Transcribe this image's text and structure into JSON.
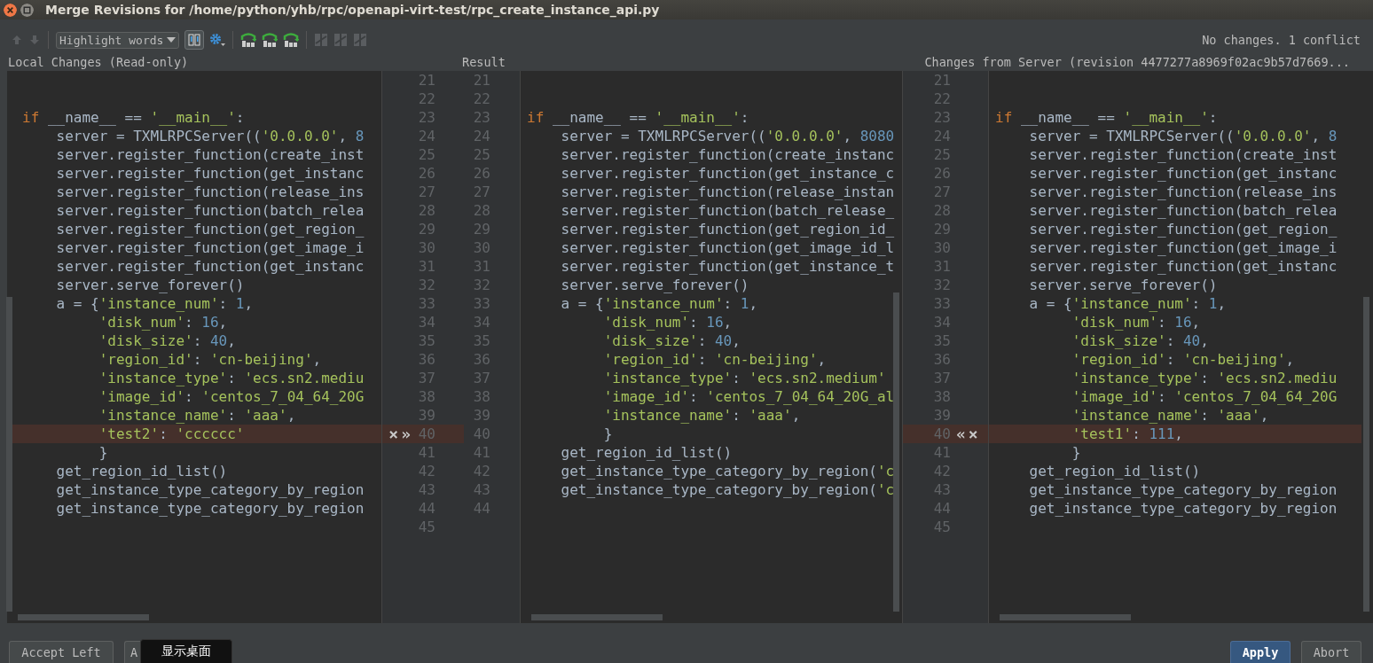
{
  "window": {
    "title": "Merge Revisions for /home/python/yhb/rpc/openapi-virt-test/rpc_create_instance_api.py"
  },
  "toolbar": [
    {
      "kind": "up",
      "disabled": true
    },
    {
      "kind": "down",
      "disabled": true
    },
    {
      "kind": "dropdown",
      "value": "Highlight words"
    },
    {
      "kind": "toggle",
      "selected": true
    },
    {
      "kind": "gear"
    },
    {
      "kind": "apply",
      "disabled": false
    },
    {
      "kind": "apply",
      "disabled": false
    },
    {
      "kind": "apply",
      "disabled": false
    },
    {
      "kind": "resolve",
      "disabled": true
    },
    {
      "kind": "resolve",
      "disabled": true
    },
    {
      "kind": "resolve",
      "disabled": true
    }
  ],
  "status": "No changes. 1 conflict",
  "headers": {
    "left": "Local Changes (Read-only)",
    "result": "Result",
    "right": "Changes from Server (revision 4477277a8969f02ac9b57d7669..."
  },
  "left_pane": {
    "lines": [
      {
        "number": "21",
        "conflict": false
      },
      {
        "number": "22",
        "conflict": false
      },
      {
        "number": "23",
        "conflict": false,
        "tokens": [
          {
            "kind": "keyword",
            "text": "if"
          },
          {
            "kind": "plain",
            "text": " __name__ == "
          },
          {
            "kind": "string",
            "text": "'__main__'"
          },
          {
            "kind": "plain",
            "text": ":"
          }
        ]
      },
      {
        "number": "24",
        "conflict": false,
        "tokens": [
          {
            "kind": "plain",
            "text": "    server = TXMLRPCServer(("
          },
          {
            "kind": "string",
            "text": "'0.0.0.0'"
          },
          {
            "kind": "plain",
            "text": ", "
          },
          {
            "kind": "number",
            "text": "8"
          }
        ]
      },
      {
        "number": "25",
        "conflict": false,
        "tokens": [
          {
            "kind": "plain",
            "text": "    server.register_function(create_inst"
          }
        ]
      },
      {
        "number": "26",
        "conflict": false,
        "tokens": [
          {
            "kind": "plain",
            "text": "    server.register_function(get_instanc"
          }
        ]
      },
      {
        "number": "27",
        "conflict": false,
        "tokens": [
          {
            "kind": "plain",
            "text": "    server.register_function(release_ins"
          }
        ]
      },
      {
        "number": "28",
        "conflict": false,
        "tokens": [
          {
            "kind": "plain",
            "text": "    server.register_function(batch_relea"
          }
        ]
      },
      {
        "number": "29",
        "conflict": false,
        "tokens": [
          {
            "kind": "plain",
            "text": "    server.register_function(get_region_"
          }
        ]
      },
      {
        "number": "30",
        "conflict": false,
        "tokens": [
          {
            "kind": "plain",
            "text": "    server.register_function(get_image_i"
          }
        ]
      },
      {
        "number": "31",
        "conflict": false,
        "tokens": [
          {
            "kind": "plain",
            "text": "    server.register_function(get_instanc"
          }
        ]
      },
      {
        "number": "32",
        "conflict": false,
        "tokens": [
          {
            "kind": "plain",
            "text": "    server.serve_forever()"
          }
        ]
      },
      {
        "number": "33",
        "conflict": false,
        "tokens": [
          {
            "kind": "plain",
            "text": "    a = {"
          },
          {
            "kind": "string",
            "text": "'instance_num'"
          },
          {
            "kind": "plain",
            "text": ": "
          },
          {
            "kind": "number",
            "text": "1"
          },
          {
            "kind": "plain",
            "text": ","
          }
        ]
      },
      {
        "number": "34",
        "conflict": false,
        "tokens": [
          {
            "kind": "string",
            "text": "         'disk_num'"
          },
          {
            "kind": "plain",
            "text": ": "
          },
          {
            "kind": "number",
            "text": "16"
          },
          {
            "kind": "plain",
            "text": ","
          }
        ]
      },
      {
        "number": "35",
        "conflict": false,
        "tokens": [
          {
            "kind": "string",
            "text": "         'disk_size'"
          },
          {
            "kind": "plain",
            "text": ": "
          },
          {
            "kind": "number",
            "text": "40"
          },
          {
            "kind": "plain",
            "text": ","
          }
        ]
      },
      {
        "number": "36",
        "conflict": false,
        "tokens": [
          {
            "kind": "string",
            "text": "         'region_id'"
          },
          {
            "kind": "plain",
            "text": ": "
          },
          {
            "kind": "string",
            "text": "'cn-beijing'"
          },
          {
            "kind": "plain",
            "text": ","
          }
        ]
      },
      {
        "number": "37",
        "conflict": false,
        "tokens": [
          {
            "kind": "string",
            "text": "         'instance_type'"
          },
          {
            "kind": "plain",
            "text": ": "
          },
          {
            "kind": "string",
            "text": "'ecs.sn2.mediu"
          }
        ]
      },
      {
        "number": "38",
        "conflict": false,
        "tokens": [
          {
            "kind": "string",
            "text": "         'image_id'"
          },
          {
            "kind": "plain",
            "text": ": "
          },
          {
            "kind": "string",
            "text": "'centos_7_04_64_20G"
          }
        ]
      },
      {
        "number": "39",
        "conflict": false,
        "tokens": [
          {
            "kind": "string",
            "text": "         'instance_name'"
          },
          {
            "kind": "plain",
            "text": ": "
          },
          {
            "kind": "string",
            "text": "'aaa'"
          },
          {
            "kind": "plain",
            "text": ","
          }
        ]
      },
      {
        "number": "40",
        "conflict": true,
        "markers": [
          "×",
          "»"
        ],
        "tokens": [
          {
            "kind": "string",
            "text": "         'test2'"
          },
          {
            "kind": "plain",
            "text": ": "
          },
          {
            "kind": "string",
            "text": "'cccccc'"
          }
        ]
      },
      {
        "number": "41",
        "conflict": false,
        "tokens": [
          {
            "kind": "plain",
            "text": "         }"
          }
        ]
      },
      {
        "number": "42",
        "conflict": false,
        "tokens": [
          {
            "kind": "plain",
            "text": "    get_region_id_list()"
          }
        ]
      },
      {
        "number": "43",
        "conflict": false,
        "tokens": [
          {
            "kind": "plain",
            "text": "    get_instance_type_category_by_region"
          }
        ]
      },
      {
        "number": "44",
        "conflict": false,
        "tokens": [
          {
            "kind": "plain",
            "text": "    get_instance_type_category_by_region"
          }
        ]
      },
      {
        "number": "45",
        "conflict": false
      }
    ]
  },
  "result_pane": {
    "lines": [
      {
        "number": "21"
      },
      {
        "number": "22"
      },
      {
        "number": "23",
        "tokens": [
          {
            "kind": "keyword",
            "text": "if"
          },
          {
            "kind": "plain",
            "text": " __name__ == "
          },
          {
            "kind": "string",
            "text": "'__main__'"
          },
          {
            "kind": "plain",
            "text": ":"
          }
        ]
      },
      {
        "number": "24",
        "tokens": [
          {
            "kind": "plain",
            "text": "    server = TXMLRPCServer(("
          },
          {
            "kind": "string",
            "text": "'0.0.0.0'"
          },
          {
            "kind": "plain",
            "text": ", "
          },
          {
            "kind": "number",
            "text": "8080"
          }
        ]
      },
      {
        "number": "25",
        "tokens": [
          {
            "kind": "plain",
            "text": "    server.register_function(create_instanc"
          }
        ]
      },
      {
        "number": "26",
        "tokens": [
          {
            "kind": "plain",
            "text": "    server.register_function(get_instance_c"
          }
        ]
      },
      {
        "number": "27",
        "tokens": [
          {
            "kind": "plain",
            "text": "    server.register_function(release_instan"
          }
        ]
      },
      {
        "number": "28",
        "tokens": [
          {
            "kind": "plain",
            "text": "    server.register_function(batch_release_"
          }
        ]
      },
      {
        "number": "29",
        "tokens": [
          {
            "kind": "plain",
            "text": "    server.register_function(get_region_id_"
          }
        ]
      },
      {
        "number": "30",
        "tokens": [
          {
            "kind": "plain",
            "text": "    server.register_function(get_image_id_l"
          }
        ]
      },
      {
        "number": "31",
        "tokens": [
          {
            "kind": "plain",
            "text": "    server.register_function(get_instance_t"
          }
        ]
      },
      {
        "number": "32",
        "tokens": [
          {
            "kind": "plain",
            "text": "    server.serve_forever()"
          }
        ]
      },
      {
        "number": "33",
        "tokens": [
          {
            "kind": "plain",
            "text": "    a = {"
          },
          {
            "kind": "string",
            "text": "'instance_num'"
          },
          {
            "kind": "plain",
            "text": ": "
          },
          {
            "kind": "number",
            "text": "1"
          },
          {
            "kind": "plain",
            "text": ","
          }
        ]
      },
      {
        "number": "34",
        "tokens": [
          {
            "kind": "string",
            "text": "         'disk_num'"
          },
          {
            "kind": "plain",
            "text": ": "
          },
          {
            "kind": "number",
            "text": "16"
          },
          {
            "kind": "plain",
            "text": ","
          }
        ]
      },
      {
        "number": "35",
        "tokens": [
          {
            "kind": "string",
            "text": "         'disk_size'"
          },
          {
            "kind": "plain",
            "text": ": "
          },
          {
            "kind": "number",
            "text": "40"
          },
          {
            "kind": "plain",
            "text": ","
          }
        ]
      },
      {
        "number": "36",
        "tokens": [
          {
            "kind": "string",
            "text": "         'region_id'"
          },
          {
            "kind": "plain",
            "text": ": "
          },
          {
            "kind": "string",
            "text": "'cn-beijing'"
          },
          {
            "kind": "plain",
            "text": ","
          }
        ]
      },
      {
        "number": "37",
        "tokens": [
          {
            "kind": "string",
            "text": "         'instance_type'"
          },
          {
            "kind": "plain",
            "text": ": "
          },
          {
            "kind": "string",
            "text": "'ecs.sn2.medium'"
          }
        ]
      },
      {
        "number": "38",
        "tokens": [
          {
            "kind": "string",
            "text": "         'image_id'"
          },
          {
            "kind": "plain",
            "text": ": "
          },
          {
            "kind": "string",
            "text": "'centos_7_04_64_20G_al"
          }
        ]
      },
      {
        "number": "39",
        "tokens": [
          {
            "kind": "string",
            "text": "         'instance_name'"
          },
          {
            "kind": "plain",
            "text": ": "
          },
          {
            "kind": "string",
            "text": "'aaa'"
          },
          {
            "kind": "plain",
            "text": ","
          }
        ]
      },
      {
        "number": "40",
        "tokens": [
          {
            "kind": "plain",
            "text": "         }"
          }
        ]
      },
      {
        "number": "41",
        "tokens": [
          {
            "kind": "plain",
            "text": "    get_region_id_list()"
          }
        ]
      },
      {
        "number": "42",
        "tokens": [
          {
            "kind": "plain",
            "text": "    get_instance_type_category_by_region("
          },
          {
            "kind": "string",
            "text": "'c"
          }
        ]
      },
      {
        "number": "43",
        "tokens": [
          {
            "kind": "plain",
            "text": "    get_instance_type_category_by_region("
          },
          {
            "kind": "string",
            "text": "'c"
          }
        ]
      },
      {
        "number": "44"
      }
    ]
  },
  "right_pane": {
    "lines": [
      {
        "number": "21",
        "conflict": false
      },
      {
        "number": "22",
        "conflict": false
      },
      {
        "number": "23",
        "conflict": false,
        "tokens": [
          {
            "kind": "keyword",
            "text": "if"
          },
          {
            "kind": "plain",
            "text": " __name__ == "
          },
          {
            "kind": "string",
            "text": "'__main__'"
          },
          {
            "kind": "plain",
            "text": ":"
          }
        ]
      },
      {
        "number": "24",
        "conflict": false,
        "tokens": [
          {
            "kind": "plain",
            "text": "    server = TXMLRPCServer(("
          },
          {
            "kind": "string",
            "text": "'0.0.0.0'"
          },
          {
            "kind": "plain",
            "text": ", "
          },
          {
            "kind": "number",
            "text": "8"
          }
        ]
      },
      {
        "number": "25",
        "conflict": false,
        "tokens": [
          {
            "kind": "plain",
            "text": "    server.register_function(create_inst"
          }
        ]
      },
      {
        "number": "26",
        "conflict": false,
        "tokens": [
          {
            "kind": "plain",
            "text": "    server.register_function(get_instanc"
          }
        ]
      },
      {
        "number": "27",
        "conflict": false,
        "tokens": [
          {
            "kind": "plain",
            "text": "    server.register_function(release_ins"
          }
        ]
      },
      {
        "number": "28",
        "conflict": false,
        "tokens": [
          {
            "kind": "plain",
            "text": "    server.register_function(batch_relea"
          }
        ]
      },
      {
        "number": "29",
        "conflict": false,
        "tokens": [
          {
            "kind": "plain",
            "text": "    server.register_function(get_region_"
          }
        ]
      },
      {
        "number": "30",
        "conflict": false,
        "tokens": [
          {
            "kind": "plain",
            "text": "    server.register_function(get_image_i"
          }
        ]
      },
      {
        "number": "31",
        "conflict": false,
        "tokens": [
          {
            "kind": "plain",
            "text": "    server.register_function(get_instanc"
          }
        ]
      },
      {
        "number": "32",
        "conflict": false,
        "tokens": [
          {
            "kind": "plain",
            "text": "    server.serve_forever()"
          }
        ]
      },
      {
        "number": "33",
        "conflict": false,
        "tokens": [
          {
            "kind": "plain",
            "text": "    a = {"
          },
          {
            "kind": "string",
            "text": "'instance_num'"
          },
          {
            "kind": "plain",
            "text": ": "
          },
          {
            "kind": "number",
            "text": "1"
          },
          {
            "kind": "plain",
            "text": ","
          }
        ]
      },
      {
        "number": "34",
        "conflict": false,
        "tokens": [
          {
            "kind": "string",
            "text": "         'disk_num'"
          },
          {
            "kind": "plain",
            "text": ": "
          },
          {
            "kind": "number",
            "text": "16"
          },
          {
            "kind": "plain",
            "text": ","
          }
        ]
      },
      {
        "number": "35",
        "conflict": false,
        "tokens": [
          {
            "kind": "string",
            "text": "         'disk_size'"
          },
          {
            "kind": "plain",
            "text": ": "
          },
          {
            "kind": "number",
            "text": "40"
          },
          {
            "kind": "plain",
            "text": ","
          }
        ]
      },
      {
        "number": "36",
        "conflict": false,
        "tokens": [
          {
            "kind": "string",
            "text": "         'region_id'"
          },
          {
            "kind": "plain",
            "text": ": "
          },
          {
            "kind": "string",
            "text": "'cn-beijing'"
          },
          {
            "kind": "plain",
            "text": ","
          }
        ]
      },
      {
        "number": "37",
        "conflict": false,
        "tokens": [
          {
            "kind": "string",
            "text": "         'instance_type'"
          },
          {
            "kind": "plain",
            "text": ": "
          },
          {
            "kind": "string",
            "text": "'ecs.sn2.mediu"
          }
        ]
      },
      {
        "number": "38",
        "conflict": false,
        "tokens": [
          {
            "kind": "string",
            "text": "         'image_id'"
          },
          {
            "kind": "plain",
            "text": ": "
          },
          {
            "kind": "string",
            "text": "'centos_7_04_64_20G"
          }
        ]
      },
      {
        "number": "39",
        "conflict": false,
        "tokens": [
          {
            "kind": "string",
            "text": "         'instance_name'"
          },
          {
            "kind": "plain",
            "text": ": "
          },
          {
            "kind": "string",
            "text": "'aaa'"
          },
          {
            "kind": "plain",
            "text": ","
          }
        ]
      },
      {
        "number": "40",
        "conflict": true,
        "markers": [
          "«",
          "×"
        ],
        "tokens": [
          {
            "kind": "string",
            "text": "         'test1'"
          },
          {
            "kind": "plain",
            "text": ": "
          },
          {
            "kind": "number",
            "text": "111"
          },
          {
            "kind": "plain",
            "text": ","
          }
        ]
      },
      {
        "number": "41",
        "conflict": false,
        "tokens": [
          {
            "kind": "plain",
            "text": "         }"
          }
        ]
      },
      {
        "number": "42",
        "conflict": false,
        "tokens": [
          {
            "kind": "plain",
            "text": "    get_region_id_list()"
          }
        ]
      },
      {
        "number": "43",
        "conflict": false,
        "tokens": [
          {
            "kind": "plain",
            "text": "    get_instance_type_category_by_region"
          }
        ]
      },
      {
        "number": "44",
        "conflict": false,
        "tokens": [
          {
            "kind": "plain",
            "text": "    get_instance_type_category_by_region"
          }
        ]
      },
      {
        "number": "45",
        "conflict": false
      }
    ]
  },
  "bottom_left_buttons": [
    {
      "label": "Accept Left"
    },
    {
      "label": "A"
    }
  ],
  "tooltip": {
    "text": "显示桌面"
  },
  "bottom_right_buttons": [
    {
      "label": "Apply",
      "default": true
    },
    {
      "label": "Abort",
      "default": false
    }
  ]
}
